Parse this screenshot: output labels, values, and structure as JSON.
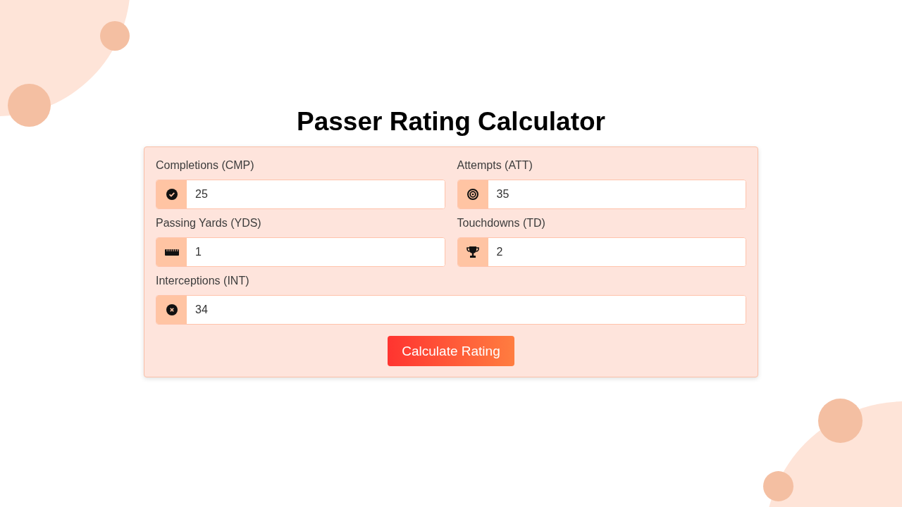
{
  "title": "Passer Rating Calculator",
  "fields": [
    {
      "label": "Completions (CMP)",
      "value": "25"
    },
    {
      "label": "Attempts (ATT)",
      "value": "35"
    },
    {
      "label": "Passing Yards (YDS)",
      "value": "1"
    },
    {
      "label": "Touchdowns (TD)",
      "value": "2"
    },
    {
      "label": "Interceptions (INT)",
      "value": "34"
    }
  ],
  "button": "Calculate Rating"
}
